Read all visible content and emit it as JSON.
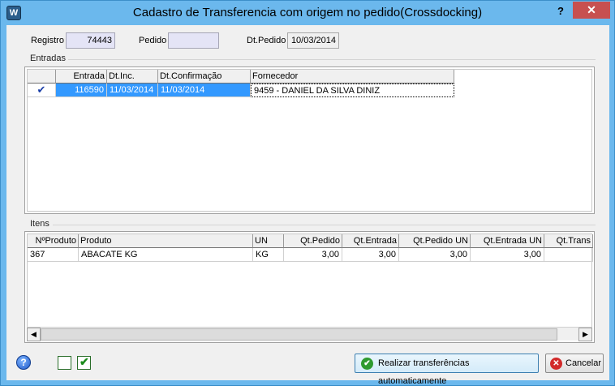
{
  "window": {
    "title": "Cadastro de Transferencia com origem no pedido(Crossdocking)",
    "help_glyph": "?",
    "close_glyph": "✕",
    "app_icon_glyph": "W"
  },
  "header": {
    "registro_label": "Registro",
    "registro_value": "74443",
    "pedido_label": "Pedido",
    "pedido_value": "",
    "dtpedido_label": "Dt.Pedido",
    "dtpedido_value": "10/03/2014"
  },
  "entradas": {
    "title": "Entradas",
    "columns": [
      "",
      "Entrada",
      "Dt.Inc.",
      "Dt.Confirmação",
      "Fornecedor"
    ],
    "rows": [
      {
        "check": "✔",
        "entrada": "116590",
        "dt_inc": "11/03/2014",
        "dt_confirmacao": "11/03/2014",
        "fornecedor": "9459 - DANIEL DA SILVA DINIZ"
      }
    ]
  },
  "itens": {
    "title": "Itens",
    "columns": [
      "NºProduto",
      "Produto",
      "UN",
      "Qt.Pedido",
      "Qt.Entrada",
      "Qt.Pedido UN",
      "Qt.Entrada UN",
      "Qt.Trans"
    ],
    "rows": [
      {
        "nproduto": "367",
        "produto": "ABACATE KG",
        "un": "KG",
        "qt_pedido": "3,00",
        "qt_entrada": "3,00",
        "qt_pedido_un": "3,00",
        "qt_entrada_un": "3,00",
        "qt_trans": ""
      }
    ]
  },
  "footer": {
    "realizar_label": "Realizar transferências automaticamente",
    "cancelar_label": "Cancelar",
    "check_glyph": "✔",
    "info_glyph": "?"
  },
  "icons": {
    "realizar": "check-circle-icon",
    "cancelar": "cancel-circle-icon",
    "help": "info-icon"
  },
  "colors": {
    "titlebar": "#6bb8ed",
    "close": "#c75050",
    "selection": "#3399ff"
  }
}
